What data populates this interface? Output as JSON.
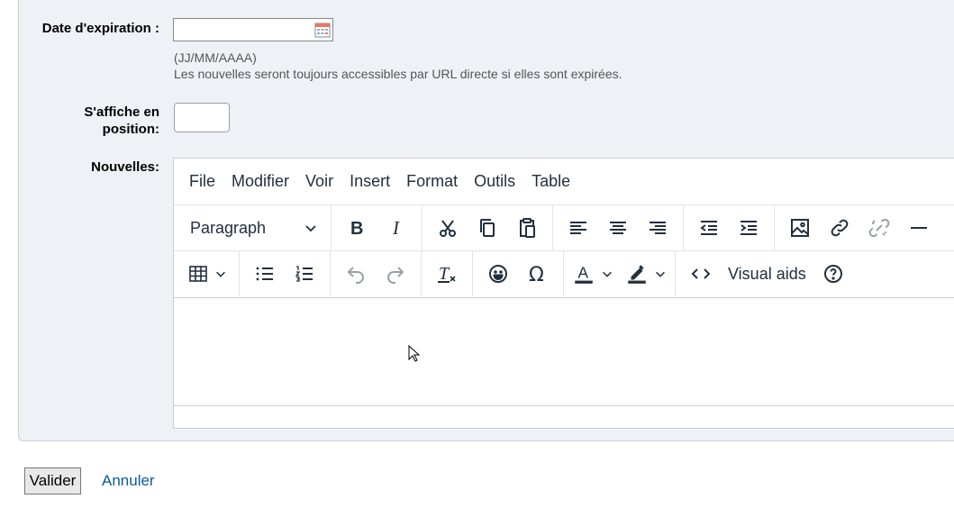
{
  "form": {
    "expiry_label": "Date d'expiration :",
    "expiry_value": "",
    "expiry_format_hint": "(JJ/MM/AAAA)",
    "expiry_note": "Les nouvelles seront toujours accessibles par URL directe si elles sont expirées.",
    "position_label_line1": "S'affiche en",
    "position_label_line2": "position:",
    "position_value": "",
    "news_label": "Nouvelles:"
  },
  "editor": {
    "menu": [
      "File",
      "Modifier",
      "Voir",
      "Insert",
      "Format",
      "Outils",
      "Table"
    ],
    "block_format": "Paragraph",
    "visual_aids_label": "Visual aids",
    "icons": {
      "row1": [
        "bold-icon",
        "italic-icon",
        "cut-icon",
        "copy-icon",
        "paste-icon",
        "align-left-icon",
        "align-center-icon",
        "align-right-icon",
        "outdent-icon",
        "indent-icon",
        "image-icon",
        "link-icon",
        "unlink-icon",
        "horizontal-rule-icon"
      ],
      "row2": [
        "table-icon",
        "bullet-list-icon",
        "numbered-list-icon",
        "undo-icon",
        "redo-icon",
        "clear-formatting-icon",
        "emoji-icon",
        "special-char-icon",
        "text-color-icon",
        "highlight-color-icon",
        "source-code-icon",
        "help-icon"
      ]
    },
    "text_color": "#222f3e",
    "disabled_color": "#9aa0a8"
  },
  "actions": {
    "submit_label": "Valider",
    "cancel_label": "Annuler",
    "link_color": "#0b5aa2"
  }
}
